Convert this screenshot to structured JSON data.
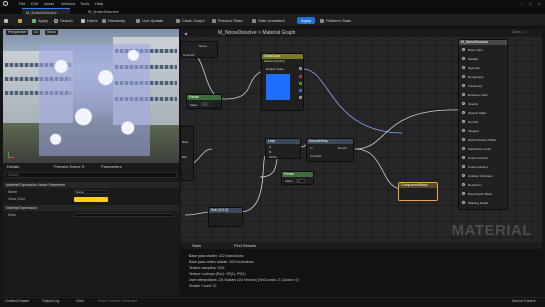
{
  "menu": [
    "File",
    "Edit",
    "Asset",
    "Window",
    "Tools",
    "Help"
  ],
  "tabs": [
    "M_NoiseDissolve",
    "M_NoiseDissolve"
  ],
  "toolbar": {
    "save": "Save",
    "apply": "Apply",
    "search": "Search",
    "home": "Home",
    "hierarchy": "Hierarchy",
    "live_update": "Live Update",
    "clean_graph": "Clean Graph",
    "preview_state": "Preview State",
    "hide_unrelated": "Hide Unrelated",
    "apply_btn": "Apply",
    "platform_stats": "Platform Stats"
  },
  "viewport": {
    "perspective": "Perspective",
    "lit": "Lit",
    "show": "Show"
  },
  "details": {
    "tabs": [
      "Details",
      "Preview Scene S",
      "Parameters"
    ],
    "search_placeholder": "Search",
    "section1": "Material Expression Vector Parameter",
    "name_label": "Name",
    "name_value": "Name",
    "color_label": "Glow Color",
    "section2": "Material Expression",
    "desc_label": "Desc",
    "glow_color": "#ffcf14"
  },
  "graph": {
    "breadcrumb": "M_NoiseDissolve > Material Graph",
    "zoom": "Zoom -1",
    "main_node": {
      "title": "M_NoiseDissolve",
      "pins": [
        "Base Color",
        "Metallic",
        "Specular",
        "Roughness",
        "Anisotropy",
        "Emissive Color",
        "Opacity",
        "Opacity Mask",
        "Normal",
        "Tangent",
        "World Position Offset",
        "Subsurface Color",
        "Custom Data 0",
        "Custom Data 1",
        "Ambient Occlusion",
        "Refraction",
        "Pixel Depth Offset",
        "Shading Model"
      ]
    },
    "param_node": {
      "title": "GlowColor",
      "subtitle": "Param (0,0,0,1)",
      "default": "Default Value",
      "color": "#1f6fff"
    },
    "scalar_node": {
      "title": "Param",
      "value_label": "Value",
      "value": "1.0"
    },
    "lerp_node": {
      "title": "Lerp",
      "a": "A",
      "b": "B",
      "alpha": "Alpha"
    },
    "clamp_node": {
      "title": "SmoothStep",
      "in": "In",
      "result": "Result",
      "contrast": "Contrast"
    },
    "subtract_node": {
      "title": "Subtract",
      "a": "A",
      "b": "B"
    },
    "scalar2_node": {
      "title": "Param",
      "value_label": "Value",
      "value": "2"
    },
    "comment_node": {
      "title": "ComponentMask"
    },
    "bottom_node": {
      "title": "Sub (0,0,0)"
    },
    "left_pins": [
      "Name",
      "Contrast",
      "Rate",
      "Blur"
    ],
    "watermark": "MATERIAL"
  },
  "stats": {
    "tabs": [
      "Stats",
      "Find Results"
    ],
    "lines": [
      "Base pass shader: 222 instructions",
      "Base pass vertex shader: 203 instructions",
      "Texture samplers: 3/16",
      "Texture Lookups (Est.): VS(1), PS(1)",
      "User interpolators: 2/4 Scalars (1/4 Vectors) (TexCoords: 2, Custom: 0)",
      "Shader Count: 12"
    ]
  },
  "status": {
    "content_drawer": "Content Drawer",
    "output_log": "Output Log",
    "cmd": "Cmd",
    "console_placeholder": "Enter Console Command",
    "source_control": "Source Control"
  }
}
